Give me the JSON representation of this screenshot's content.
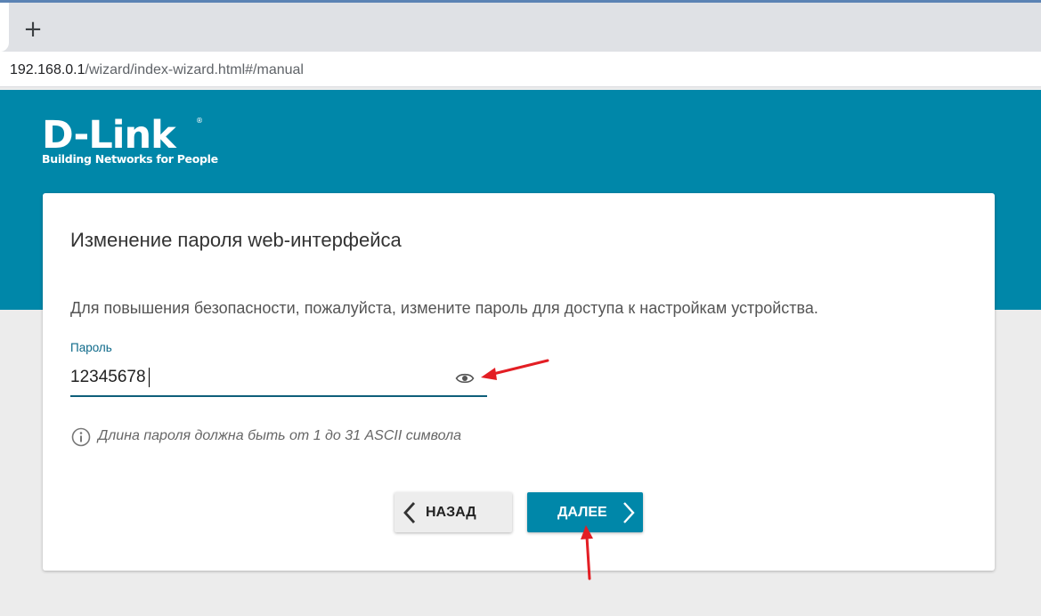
{
  "browser": {
    "new_tab_label": "+",
    "url_host": "192.168.0.1",
    "url_path": "/wizard/index-wizard.html#/manual"
  },
  "brand": {
    "logo_text": "D-Link",
    "registered_mark": "®",
    "tagline": "Building Networks for People",
    "color": "#0087a9"
  },
  "wizard": {
    "title": "Изменение пароля web-интерфейса",
    "description": "Для повышения безопасности, пожалуйста, измените пароль для доступа к настройкам устройства.",
    "password_label": "Пароль",
    "password_value": "12345678",
    "hint": "Длина пароля должна быть от 1 до 31 ASCII символа",
    "icons": {
      "toggle_visibility": "eye-icon",
      "hint": "info-icon",
      "back": "chevron-left-icon",
      "next": "chevron-right-icon"
    }
  },
  "buttons": {
    "back_label": "НАЗАД",
    "next_label": "ДАЛЕЕ"
  },
  "annotations": {
    "arrow_color": "#e31e24"
  }
}
